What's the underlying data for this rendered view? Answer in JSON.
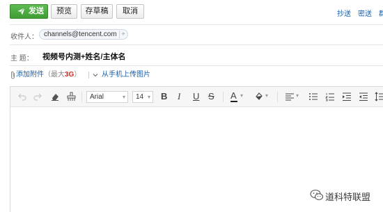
{
  "toolbar": {
    "send_label": "发送",
    "preview_label": "预览",
    "save_draft_label": "存草稿",
    "cancel_label": "取消",
    "cc_label": "抄送",
    "bcc_label": "密送",
    "separate_label": "群"
  },
  "compose": {
    "to_label": "收件人：",
    "recipient": "channels@tencent.com",
    "recipient_add": "+",
    "subject_label": "主  题：",
    "subject_value": "视频号内测+姓名/主体名"
  },
  "attachment": {
    "add_label": "添加附件",
    "limit_prefix": "（最大",
    "limit_value": "3G",
    "limit_suffix": "）",
    "mobile_upload_label": "从手机上传图片"
  },
  "editor": {
    "font_family": "Arial",
    "font_size": "14",
    "icons": [
      "undo-icon",
      "redo-icon",
      "eraser-icon",
      "format-painter-icon",
      "bold-icon",
      "italic-icon",
      "underline-icon",
      "strikethrough-icon",
      "font-color-icon",
      "highlight-icon",
      "align-icon",
      "bullet-list-icon",
      "numbered-list-icon",
      "indent-icon",
      "outdent-icon",
      "line-height-icon"
    ],
    "bold_glyph": "B",
    "italic_glyph": "I",
    "underline_glyph": "U",
    "strike_glyph": "S",
    "color_glyph": "A"
  },
  "watermark": {
    "text": "道科特联盟"
  },
  "colors": {
    "send_green": "#4caf42",
    "link_blue": "#1a5fa8",
    "limit_red": "#d12a1f"
  }
}
